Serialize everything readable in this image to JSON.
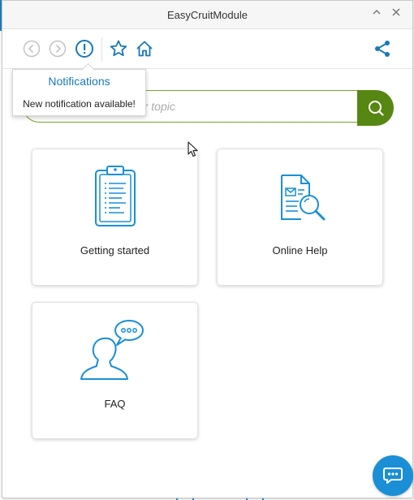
{
  "window": {
    "title": "EasyCruitModule"
  },
  "titlebar": {
    "collapse_icon": "^",
    "close_icon": "×"
  },
  "toolbar": {
    "icons": [
      "back-icon",
      "forward-icon",
      "notification-icon",
      "favorite-star-icon",
      "home-icon",
      "share-icon"
    ],
    "accent_color": "#1a78b8"
  },
  "tooltip": {
    "title": "Notifications",
    "message": "New notification available!"
  },
  "search": {
    "placeholder": "Search by keyword or topic",
    "visible_fragment": "d or topic",
    "button_color": "#568712"
  },
  "cards": [
    {
      "label": "Getting started",
      "icon": "clipboard-icon"
    },
    {
      "label": "Online Help",
      "icon": "document-search-icon"
    },
    {
      "label": "FAQ",
      "icon": "person-speech-bubble-icon"
    }
  ],
  "chat": {
    "icon": "chat-bubble-icon",
    "color": "#1a8fd6"
  }
}
